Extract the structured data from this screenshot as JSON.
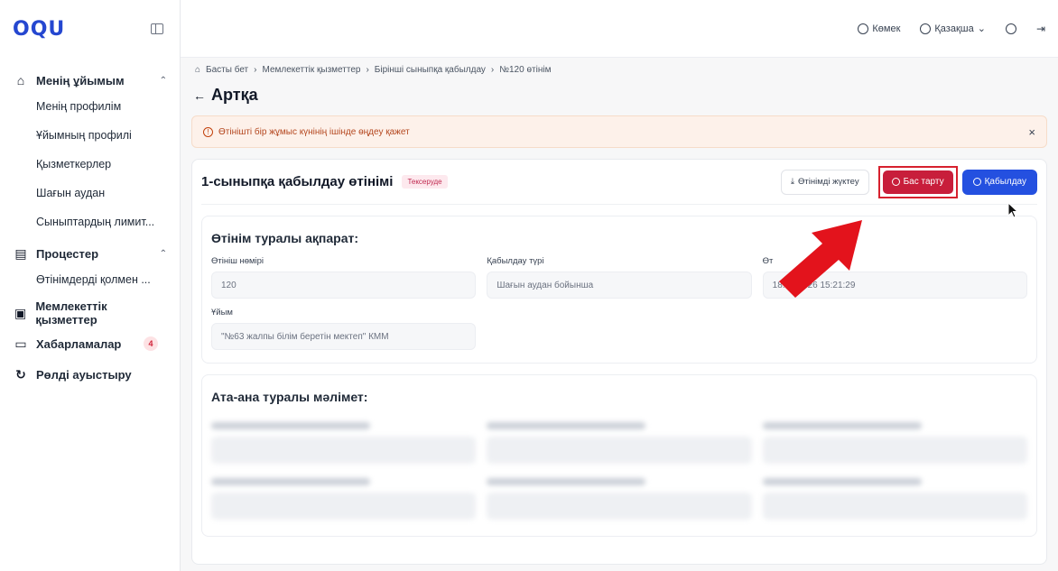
{
  "brand": {
    "logo": "OQU"
  },
  "sidebar": {
    "org_group": {
      "label": "Менің ұйымым",
      "items": [
        "Менің профилім",
        "Ұйымның профилі",
        "Қызметкерлер",
        "Шағын аудан",
        "Сыныптардың лимит..."
      ]
    },
    "process_group": {
      "label": "Процестер",
      "items": [
        "Өтінімдерді қолмен ..."
      ]
    },
    "state_services": {
      "label": "Мемлекеттік қызметтер"
    },
    "notifications": {
      "label": "Хабарламалар",
      "count": "4"
    },
    "switch_role": {
      "label": "Рөлді ауыстыру"
    }
  },
  "topbar": {
    "help": "Көмек",
    "language": "Қазақша"
  },
  "breadcrumb": [
    "Басты бет",
    "Мемлекеттік қызметтер",
    "Бірінші сыныпқа қабылдау",
    "№120 өтінім"
  ],
  "back_label": "Артқа",
  "alert": {
    "text": "Өтінішті бір жұмыс күнінің ішінде өңдеу қажет"
  },
  "application": {
    "title": "1-сыныпқа қабылдау өтінімі",
    "status": "Тексеруде",
    "download_label": "Өтінімді жүктеу",
    "reject_label": "Бас тарту",
    "accept_label": "Қабылдау"
  },
  "info_section": {
    "title": "Өтінім туралы ақпарат:",
    "fields": [
      {
        "label": "Өтініш нөмірі",
        "value": "120"
      },
      {
        "label": "Қабылдау түрі",
        "value": "Шағын аудан бойынша"
      },
      {
        "label": "Өт",
        "value": "18.05.2026 15:21:29"
      },
      {
        "label": "Ұйым",
        "value": "\"№63 жалпы білім беретін мектеп\" КММ"
      }
    ]
  },
  "parent_section": {
    "title": "Ата-ана туралы мәлімет:"
  },
  "colors": {
    "accent": "#2450e0",
    "danger": "#c81e3b",
    "annotation": "#e3131c"
  }
}
